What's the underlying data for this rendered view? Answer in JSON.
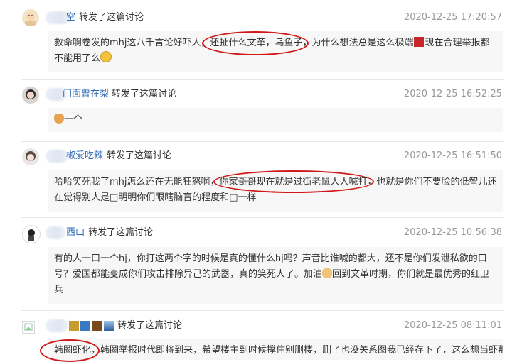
{
  "posts": [
    {
      "username": "空",
      "action": "转发了这篇讨论",
      "time": "2020-12-25 17:20:57",
      "content_a": "救命啊卷发的mhj这八千言论好吓人，",
      "content_hl": "还扯什么文革，乌鱼子，",
      "content_b": "为什么想法总是这么极端",
      "content_c": "现在合理举报都",
      "content_d": "不能用了么",
      "emoji_badge": "red-badge-icon",
      "emoji_face": "laugh-emoji-icon"
    },
    {
      "username": "门面曾在梨",
      "action": "转发了这篇讨论",
      "time": "2020-12-25 16:52:25",
      "content": "一个",
      "emoji": "cat-emoji-icon"
    },
    {
      "username": "椒爱吃辣",
      "action": "转发了这篇讨论",
      "time": "2020-12-25 16:51:50",
      "content_a": "哈哈笑死我了mhj怎么还在无能狂怒啊，",
      "content_hl": "你家哥哥现在就是过街老鼠人人喊打，",
      "content_b": "也就是你们不要脸的低智儿还",
      "content_c": "在觉得别人是□明明你们眼瞎脑盲的程度和□一样"
    },
    {
      "username": "西山",
      "action": "转发了这篇讨论",
      "time": "2020-12-25 10:56:38",
      "content_a": "有的人一口一个hj，你打这两个字的时候是真的懂什么hj吗？声音比谁喊的都大，还不是你们发泄私欲的口",
      "content_b": "号？爱国都能变成你们攻击排除异己的武器，真的笑死人了。加油",
      "content_c": "回到文革时期，你们就是最优秀的红卫",
      "content_d": "兵"
    },
    {
      "username": "",
      "action": "转发了这篇讨论",
      "time": "2020-12-25 08:11:01",
      "content_hl": "韩圈虾化",
      "content_b": "，韩圈举报时代即将到来，希望楼主到时候撑住别删楼，删了也没关系图我已经存下了，这么想当虾那么"
    }
  ]
}
